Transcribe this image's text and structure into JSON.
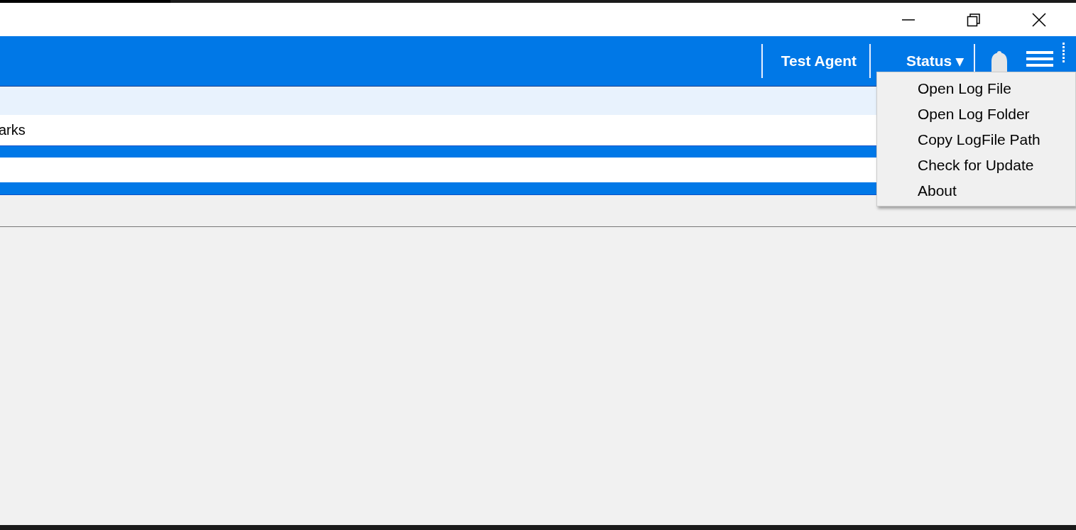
{
  "header": {
    "agent_name": "Test Agent",
    "status_menu": {
      "label": "Status",
      "caret": "▾"
    }
  },
  "rows": [
    {
      "kind": "highlight",
      "text": ""
    },
    {
      "kind": "plain",
      "text": "arks"
    }
  ],
  "menu": {
    "items": [
      {
        "label": "Open Log File"
      },
      {
        "label": "Open Log Folder"
      },
      {
        "label": "Copy LogFile Path"
      },
      {
        "label": "Check for Update"
      },
      {
        "label": "About"
      }
    ]
  }
}
